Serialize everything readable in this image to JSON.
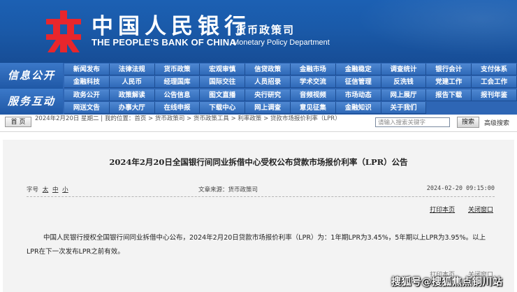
{
  "header": {
    "cn_name": "中国人民银行",
    "en_name": "THE PEOPLE'S BANK OF CHINA",
    "dept_cn": "货币政策司",
    "dept_en": "Monetary Policy Department",
    "logo_icon": "pboc-emblem-icon",
    "logo_color": "#e8262c",
    "banner_color": "#1a5aa9"
  },
  "nav": {
    "row1_label": "信息公开",
    "row2_label": "服务互动",
    "row1_items": [
      "新闻发布",
      "法律法规",
      "货币政策",
      "宏观审慎",
      "信贷政策",
      "金融市场",
      "金融稳定",
      "调查统计",
      "银行会计",
      "支付体系",
      "金融科技",
      "人民币",
      "经理国库",
      "国际交往",
      "人员招录",
      "学术交流",
      "征信管理",
      "反洗钱",
      "党建工作",
      "工会工作"
    ],
    "row2_items": [
      "政务公开",
      "政策解读",
      "公告信息",
      "图文直播",
      "央行研究",
      "音频视频",
      "市场动态",
      "网上展厅",
      "报告下载",
      "报刊年鉴",
      "网送文告",
      "办事大厅",
      "在线申报",
      "下载中心",
      "网上调查",
      "意见征集",
      "金融知识",
      "关于我们"
    ]
  },
  "crumb": {
    "home_label": "首 页",
    "path": "2024年2月20日 星期二 | 我的位置：首页 > 货币政策司 > 货币政策工具 > 利率政策 > 贷款市场报价利率（LPR）",
    "search_placeholder": "请输入搜索关键字",
    "search_button": "搜索",
    "advanced": "高级搜索"
  },
  "article": {
    "title": "2024年2月20日全国银行间同业拆借中心受权公布贷款市场报价利率（LPR）公告",
    "font_size_label": "字号",
    "font_sizes": [
      "太",
      "中",
      "小"
    ],
    "source": "文章来源：货币政策司",
    "date": "2024-02-20 09:15:00",
    "print": "打印本页",
    "close": "关闭窗口",
    "body": "中国人民银行授权全国银行间同业拆借中心公布，2024年2月20日贷款市场报价利率（LPR）为：1年期LPR为3.45%，5年期以上LPR为3.95%。以上LPR在下一次发布LPR之前有效。"
  },
  "watermark": "搜狐号@搜狐焦点铜川站"
}
